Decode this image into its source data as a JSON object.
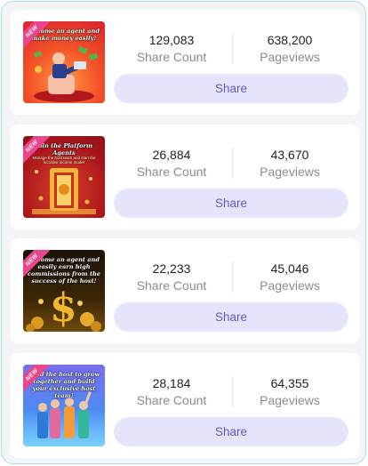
{
  "cards": [
    {
      "badge": "NEW",
      "thumb_title": "Become an agent and make money easily!",
      "thumb_sub": "",
      "share_count": "129,083",
      "share_count_label": "Share Count",
      "pageviews": "638,200",
      "pageviews_label": "Pageviews",
      "button": "Share"
    },
    {
      "badge": "NEW",
      "thumb_title": "Join the Platform Agents",
      "thumb_sub": "Manage the host team and start the lucrative income mode!",
      "share_count": "26,884",
      "share_count_label": "Share Count",
      "pageviews": "43,670",
      "pageviews_label": "Pageviews",
      "button": "Share"
    },
    {
      "badge": "NEW",
      "thumb_title": "Become an agent and easily earn high commissions from the success of the host!",
      "thumb_sub": "",
      "share_count": "22,233",
      "share_count_label": "Share Count",
      "pageviews": "45,046",
      "pageviews_label": "Pageviews",
      "button": "Share"
    },
    {
      "badge": "NEW",
      "thumb_title": "Lead the host to grow together and build your exclusive host team!",
      "thumb_sub": "",
      "share_count": "28,184",
      "share_count_label": "Share Count",
      "pageviews": "64,355",
      "pageviews_label": "Pageviews",
      "button": "Share"
    }
  ],
  "colors": {
    "frame_border": "#a9dcf2",
    "background": "#f3f4f6",
    "button_bg": "#e4e4fb",
    "button_text": "#5d5fbf",
    "badge": "#e8478d"
  }
}
